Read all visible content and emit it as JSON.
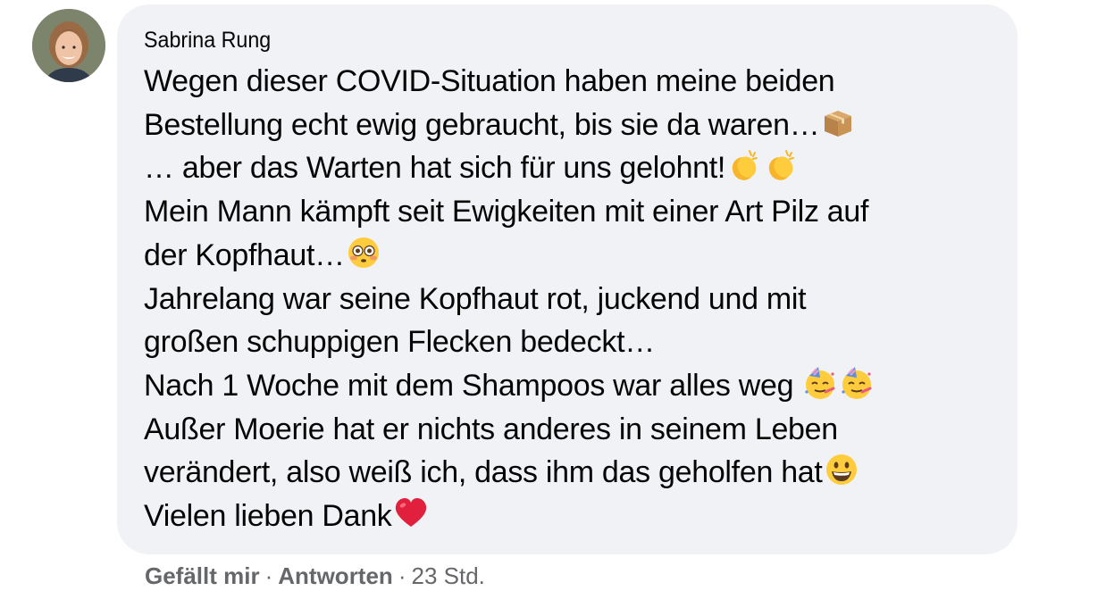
{
  "comment": {
    "author": "Sabrina Rung",
    "lines": [
      "Wegen dieser COVID-Situation haben meine beiden",
      "Bestellung echt ewig gebraucht, bis sie da waren…",
      "… aber das Warten hat sich für uns gelohnt!",
      "Mein Mann kämpft seit Ewigkeiten mit einer Art Pilz auf",
      "der Kopfhaut…",
      "Jahrelang war seine Kopfhaut rot, juckend und mit",
      "großen schuppigen Flecken bedeckt…",
      "Nach 1 Woche mit dem Shampoos war alles weg ",
      "Außer Moerie hat er nichts anderes in seinem Leben",
      "verändert, also weiß ich, dass ihm das geholfen hat",
      "Vielen lieben Dank"
    ],
    "emojis": {
      "package": "package-emoji",
      "clap": "clapping-hands-emoji",
      "flushed": "flushed-face-emoji",
      "party": "partying-face-emoji",
      "grin": "grinning-face-emoji",
      "heart": "red-heart-emoji"
    }
  },
  "actions": {
    "like": "Gefällt mir",
    "separator": "·",
    "reply": "Antworten",
    "time": "23 Std."
  },
  "colors": {
    "bubble": "#f0f2f5",
    "text": "#050505",
    "meta": "#65676b"
  }
}
